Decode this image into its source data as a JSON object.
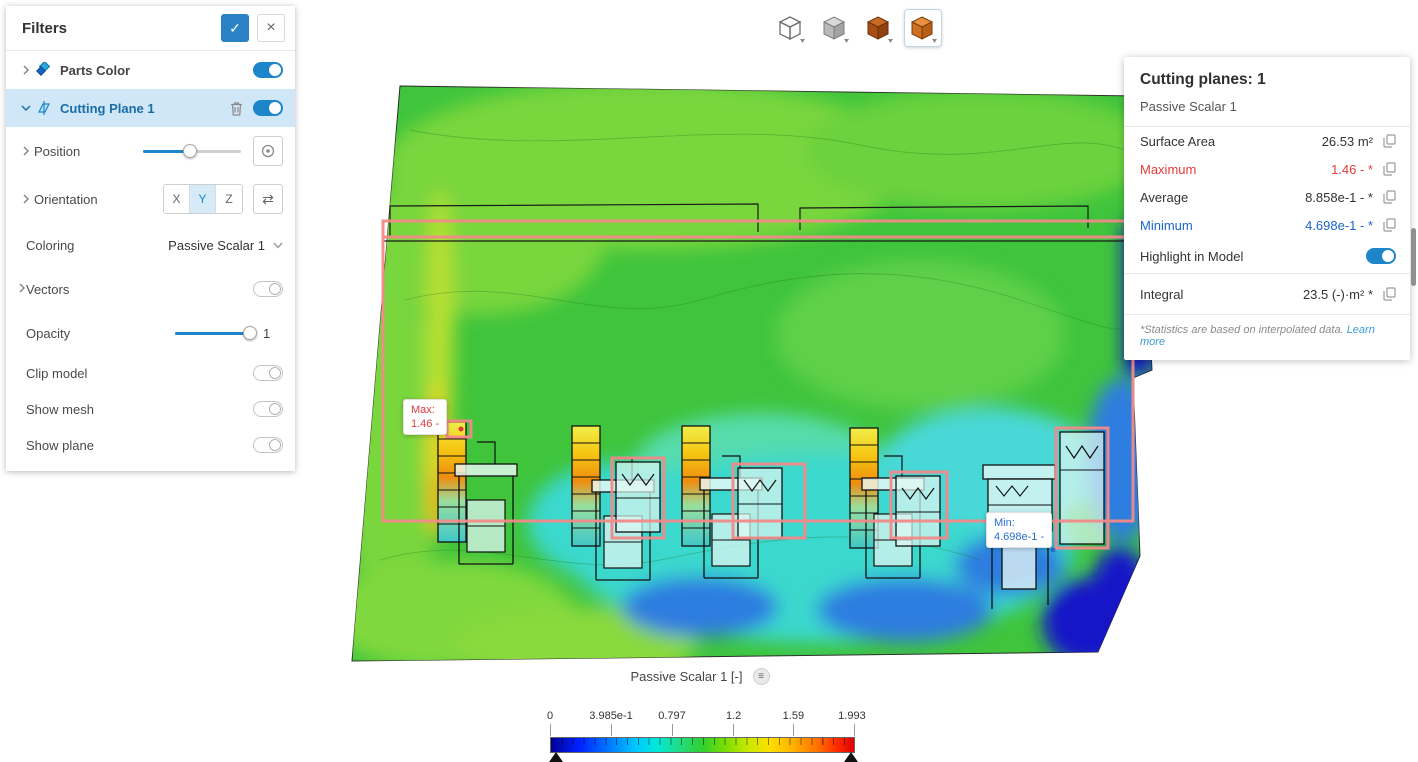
{
  "toolbar": {
    "buttons": [
      {
        "name": "wireframe-cube-view",
        "icon": "wireframe-cube-icon",
        "selected": false
      },
      {
        "name": "gray-cube-view",
        "icon": "solid-gray-cube-icon",
        "selected": false
      },
      {
        "name": "model-cube-view",
        "icon": "dark-orange-cube-icon",
        "selected": false
      },
      {
        "name": "result-cube-view",
        "icon": "orange-cube-icon",
        "selected": true
      }
    ]
  },
  "filters_panel": {
    "title": "Filters",
    "confirm_icon": "✓",
    "close_icon": "×",
    "parts_color": {
      "label": "Parts Color",
      "enabled": true
    },
    "cutting_plane": {
      "label": "Cutting Plane 1",
      "enabled": true
    },
    "position": {
      "label": "Position"
    },
    "orientation": {
      "label": "Orientation",
      "axes": [
        "X",
        "Y",
        "Z"
      ],
      "selected_axis": "Y",
      "flip_icon": "⇄"
    },
    "coloring": {
      "label": "Coloring",
      "value": "Passive Scalar 1"
    },
    "vectors": {
      "label": "Vectors",
      "enabled": false
    },
    "opacity": {
      "label": "Opacity",
      "value": "1"
    },
    "clip_model": {
      "label": "Clip model",
      "enabled": false
    },
    "show_mesh": {
      "label": "Show mesh",
      "enabled": false
    },
    "show_plane": {
      "label": "Show plane",
      "enabled": false
    }
  },
  "stats_panel": {
    "title": "Cutting planes: 1",
    "subtitle": "Passive Scalar 1",
    "rows": [
      {
        "label": "Surface Area",
        "value": "26.53 m²",
        "tone": "default"
      },
      {
        "label": "Maximum",
        "value": "1.46 - *",
        "tone": "max"
      },
      {
        "label": "Average",
        "value": "8.858e-1 - *",
        "tone": "default"
      },
      {
        "label": "Minimum",
        "value": "4.698e-1 - *",
        "tone": "min"
      }
    ],
    "highlight": {
      "label": "Highlight in Model",
      "enabled": true
    },
    "integral": {
      "label": "Integral",
      "value": "23.5 (-)·m² *"
    },
    "footnote": "*Statistics are based on interpolated data. ",
    "footnote_link": "Learn more"
  },
  "viewport": {
    "max_callout": {
      "label": "Max:",
      "value": "1.46 -"
    },
    "min_callout": {
      "label": "Min:",
      "value": "4.698e-1 -"
    }
  },
  "legend": {
    "title": "Passive Scalar 1 [-]",
    "menu_icon": "≡",
    "ticks": [
      "0",
      "3.985e-1",
      "0.797",
      "1.2",
      "1.59",
      "1.993"
    ],
    "min": 0,
    "max": 1.993
  },
  "colors": {
    "accent_blue": "#1d86ca",
    "selected_row_bg": "#cfe7f7",
    "max_red": "#e23b3b",
    "min_blue": "#1b66c9",
    "highlight_salmon": "#f38a8a",
    "link_blue": "#3a9bd5"
  }
}
